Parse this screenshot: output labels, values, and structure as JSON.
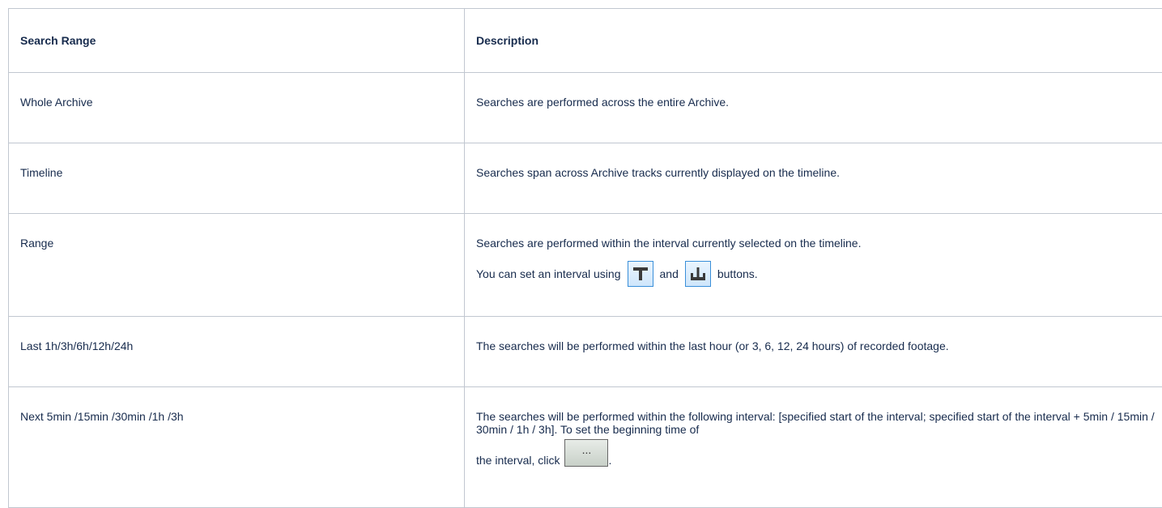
{
  "table": {
    "headers": [
      "Search Range",
      "Description"
    ],
    "rows": [
      {
        "range": "Whole Archive",
        "description": "Searches are performed across the entire Archive."
      },
      {
        "range": "Timeline",
        "description": "Searches span across Archive tracks currently displayed on the timeline."
      },
      {
        "range": "Range",
        "description": "Searches are performed within the interval currently selected on the timeline.",
        "line2_before": "You can set an interval using",
        "line2_and": "and",
        "line2_after": "buttons."
      },
      {
        "range": "Last 1h/3h/6h/12h/24h",
        "description": "The searches will be performed within the last hour (or 3, 6, 12, 24 hours) of recorded footage."
      },
      {
        "range": "Next 5min /15min /30min /1h /3h",
        "description": "The searches will be performed within the following interval: [specified start of the interval; specified start of the interval + 5min / 15min / 30min / 1h / 3h]. To set the beginning time of",
        "click_text": "the interval, click",
        "button_label": "...",
        "end_punct": "."
      }
    ]
  },
  "icons": [
    "interval-start-icon",
    "interval-end-icon"
  ],
  "colors": {
    "border": "#c1c7d0",
    "text": "#172b4d",
    "icon_border": "#3a8fd9"
  }
}
